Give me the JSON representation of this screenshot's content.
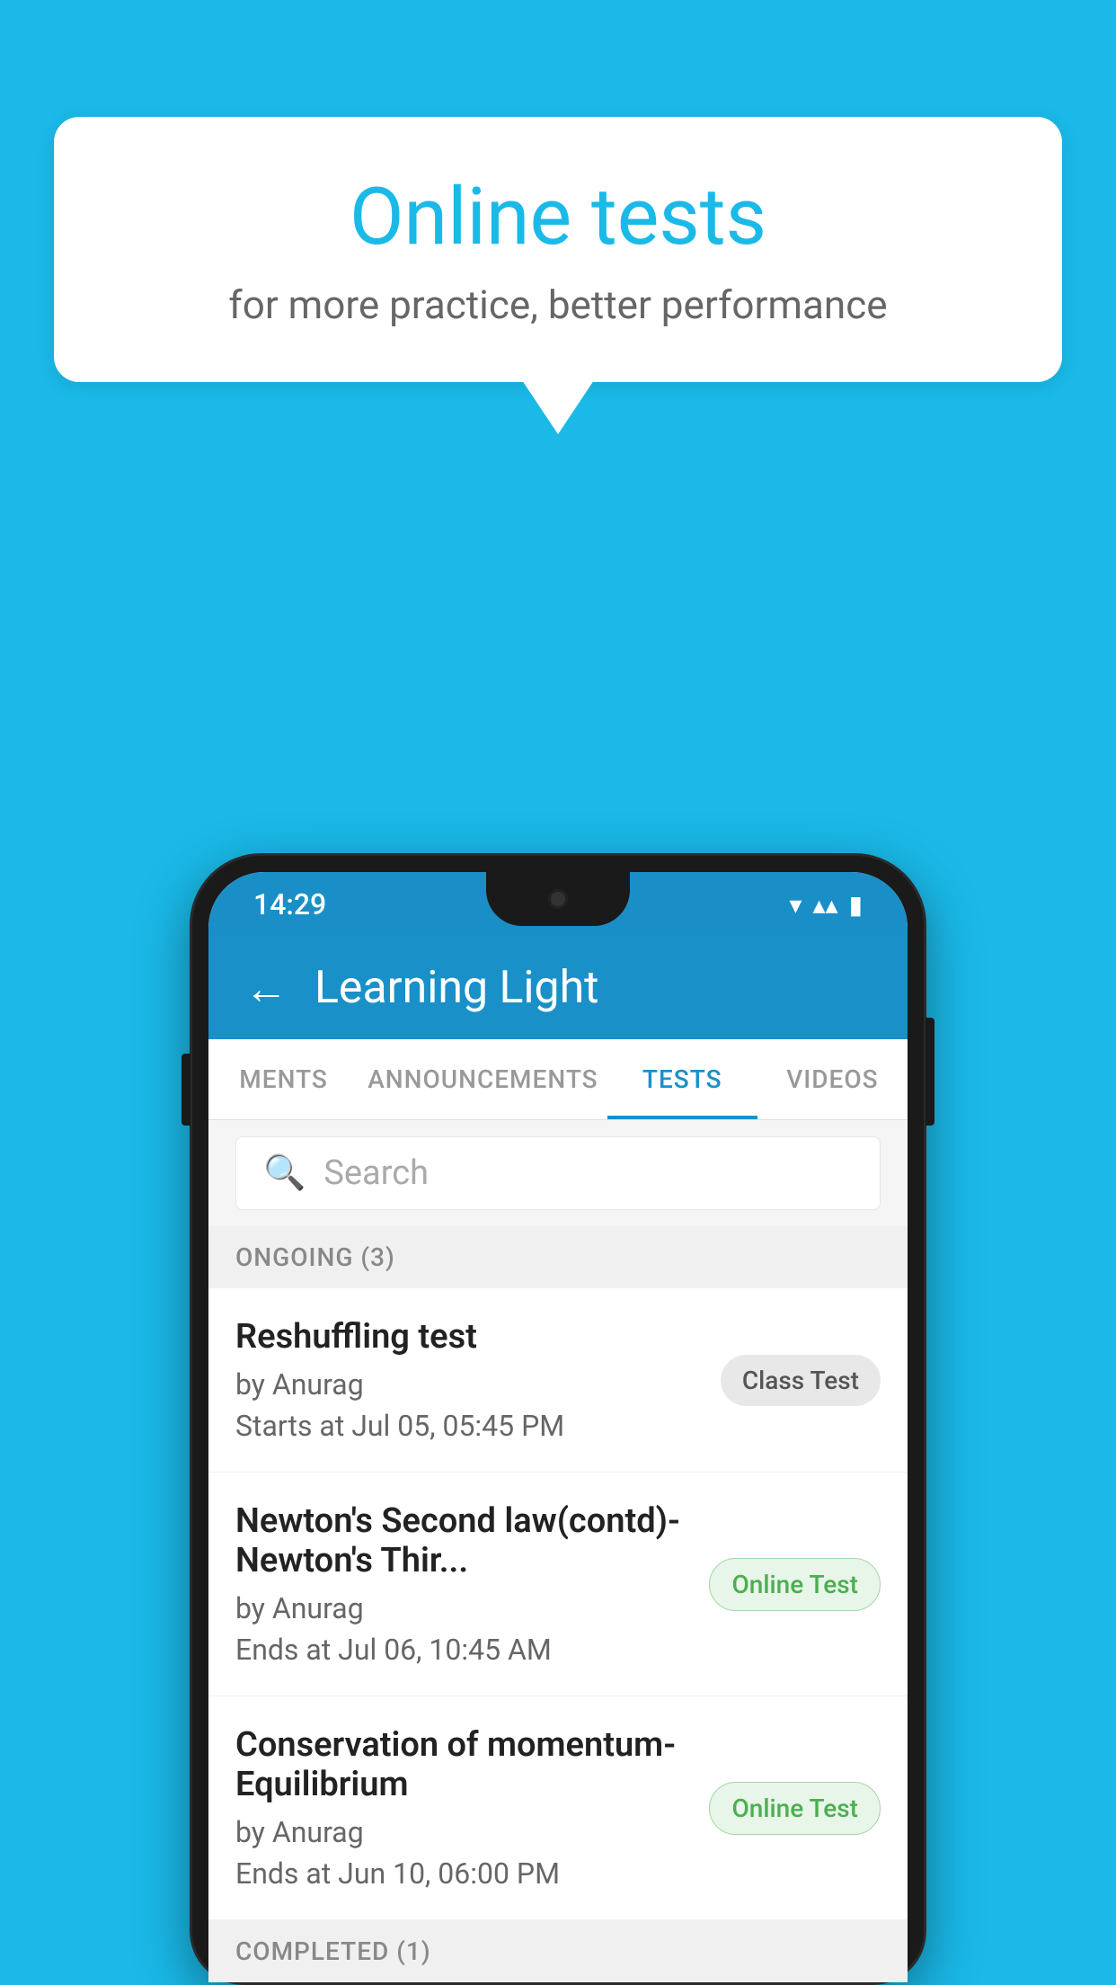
{
  "background": {
    "color": "#1ab9e8"
  },
  "speech_bubble": {
    "title": "Online tests",
    "subtitle": "for more practice, better performance"
  },
  "phone": {
    "status_bar": {
      "time": "14:29",
      "wifi": "▼",
      "signal": "▲",
      "battery": "▮"
    },
    "header": {
      "back_label": "←",
      "title": "Learning Light"
    },
    "tabs": [
      {
        "label": "MENTS",
        "active": false
      },
      {
        "label": "ANNOUNCEMENTS",
        "active": false
      },
      {
        "label": "TESTS",
        "active": true
      },
      {
        "label": "VIDEOS",
        "active": false
      }
    ],
    "search": {
      "placeholder": "Search"
    },
    "sections": [
      {
        "title": "ONGOING (3)",
        "items": [
          {
            "title": "Reshuffling test",
            "author": "by Anurag",
            "time_label": "Starts at",
            "time": "Jul 05, 05:45 PM",
            "badge": "Class Test",
            "badge_type": "class"
          },
          {
            "title": "Newton's Second law(contd)-Newton's Thir...",
            "author": "by Anurag",
            "time_label": "Ends at",
            "time": "Jul 06, 10:45 AM",
            "badge": "Online Test",
            "badge_type": "online"
          },
          {
            "title": "Conservation of momentum-Equilibrium",
            "author": "by Anurag",
            "time_label": "Ends at",
            "time": "Jun 10, 06:00 PM",
            "badge": "Online Test",
            "badge_type": "online"
          }
        ]
      },
      {
        "title": "COMPLETED (1)",
        "items": []
      }
    ]
  }
}
